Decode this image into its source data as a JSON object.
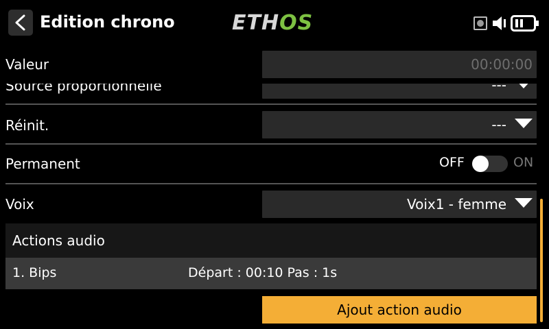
{
  "header": {
    "title": "Edition chrono",
    "logo_left": "ETH",
    "logo_right": "OS",
    "icons": [
      "back-icon",
      "record-icon",
      "speaker-icon",
      "battery-icon"
    ],
    "colors": {
      "logo_accent": "#7dc142",
      "accent": "#f4ae36"
    }
  },
  "rows": {
    "valeur": {
      "label": "Valeur",
      "value": "00:00:00"
    },
    "source": {
      "label": "Source proportionnelle",
      "value": "---"
    },
    "reinit": {
      "label": "Réinit.",
      "value": "---"
    },
    "permanent": {
      "label": "Permanent",
      "off": "OFF",
      "on": "ON",
      "state": "off"
    },
    "voix": {
      "label": "Voix",
      "value": "Voix1 - femme"
    }
  },
  "audio": {
    "title": "Actions audio",
    "items": [
      {
        "name": "1. Bips",
        "detail": "Départ : 00:10 Pas : 1s"
      }
    ],
    "add_label": "Ajout action audio"
  }
}
